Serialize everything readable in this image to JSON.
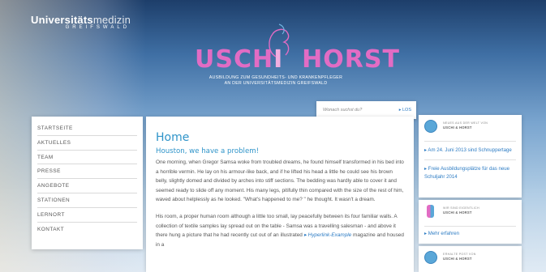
{
  "header": {
    "brand_bold": "Universitäts",
    "brand_thin": "medizin",
    "brand_sub": "GREIFSWALD",
    "logo_left": "USCH",
    "logo_i": "I",
    "logo_right": "HORST",
    "tagline_line1": "AUSBILDUNG ZUM GESUNDHEITS- UND KRANKENPFLEGER",
    "tagline_line2": "AN DER UNIVERSITÄTSMEDIZIN GREIFSWALD"
  },
  "search": {
    "placeholder": "Wonach suchst du?",
    "button": "▸ LOS"
  },
  "nav": {
    "items": [
      "STARTSEITE",
      "AKTUELLES",
      "TEAM",
      "PRESSE",
      "ANGEBOTE",
      "STATIONEN",
      "LERNORT",
      "KONTAKT"
    ]
  },
  "main": {
    "title": "Home",
    "subtitle": "Houston, we have a problem!",
    "para1": "One morning, when Gregor Samsa woke from troubled dreams, he found himself transformed in his bed into a horrible vermin. He lay on his armour-like back, and if he lifted his head a little he could see his brown belly, slightly domed and divided by arches into stiff sections. The bedding was hardly able to cover it and seemed ready to slide off any moment. His many legs, pitifully thin compared with the size of the rest of him, waved about helplessly as he looked. \"What's happened to me? \" he thought. It wasn't a dream.",
    "para2_a": "His room, a proper human room although a little too small, lay peacefully between its four familiar walls. A collection of textile samples lay spread out on the table - Samsa was a travelling salesman - and above it there hung a picture that he had recently cut out of an illustrated ",
    "para2_link": "▸ Hyperlink-Example",
    "para2_b": " magazine and housed in a"
  },
  "sidebar": {
    "news_card": {
      "kicker": "NEUES AUS DER WELT VON",
      "title": "USCHI & HORST",
      "items": [
        "▸ Am 24. Juni 2013 sind Schnuppertage",
        "▸ Freie Ausbildungsplätze für das neue Schuljahr 2014"
      ]
    },
    "about_card": {
      "kicker": "WIR SIND EIGENTLICH",
      "title": "USCHI & HORST",
      "link": "▸ Mehr erfahren"
    },
    "mail_card": {
      "kicker": "ERHALTE POST VON",
      "title": "USCHI & HORST"
    }
  },
  "colors": {
    "accent_blue": "#2f94c9",
    "logo_pink": "#e26cc4"
  }
}
